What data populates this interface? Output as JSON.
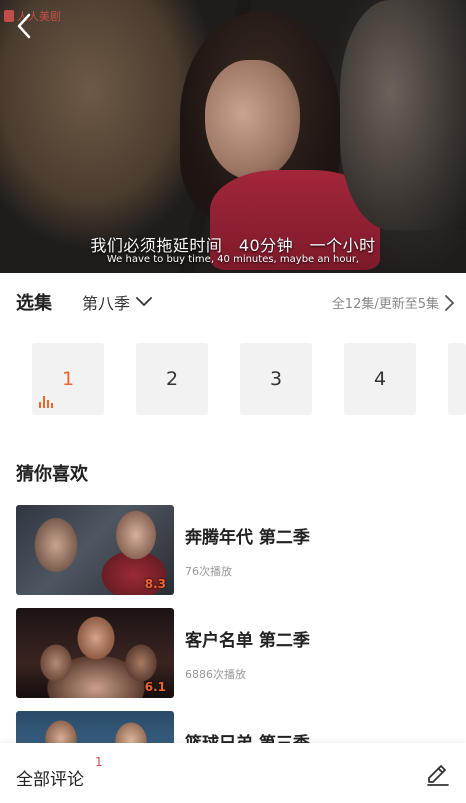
{
  "player": {
    "watermark": "人人美剧",
    "subtitle_cn": "我们必须拖延时间　40分钟　一个小时",
    "subtitle_en": "We have to buy time, 40 minutes, maybe an hour,"
  },
  "episodes": {
    "title": "选集",
    "season": "第八季",
    "info": "全12集/更新至5集",
    "items": [
      "1",
      "2",
      "3",
      "4"
    ],
    "active_index": 0
  },
  "recommendations": {
    "title": "猜你喜欢",
    "items": [
      {
        "name": "奔腾年代 第二季",
        "plays": "76次播放",
        "rating": "8.3"
      },
      {
        "name": "客户名单 第二季",
        "plays": "6886次播放",
        "rating": "6.1"
      },
      {
        "name": "篮球兄弟 第三季",
        "plays": "",
        "rating": ""
      }
    ]
  },
  "bottom_bar": {
    "comments_label": "全部评论",
    "comments_count": "1"
  },
  "colors": {
    "accent": "#f0642d",
    "badge": "#e34d59"
  },
  "icons": [
    "back-arrow-icon",
    "chevron-down-icon",
    "chevron-right-icon",
    "playing-bars-icon",
    "edit-pencil-icon"
  ]
}
